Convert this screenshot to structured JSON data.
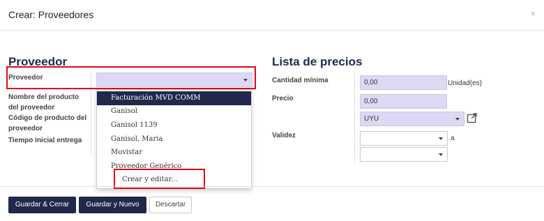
{
  "dialog": {
    "title": "Crear: Proveedores",
    "close_glyph": "×"
  },
  "proveedor_section": {
    "title": "Proveedor",
    "fields": {
      "proveedor_label": "Proveedor",
      "nombre_label": "Nombre del producto del proveedor",
      "codigo_label": "Código de producto del proveedor",
      "tiempo_label": "Tiempo inicial entrega"
    }
  },
  "dropdown": {
    "items": [
      "Facturación MVD COMM",
      "Ganisol",
      "Ganisol 1139",
      "Ganisol, Maria",
      "Movistar",
      "Proveedor Genérico"
    ],
    "create_edit_label": "Crear y editar..."
  },
  "precios_section": {
    "title": "Lista de precios",
    "cantidad_label": "Cantidad mínima",
    "cantidad_value": "0,00",
    "unidad_suffix": "Unidad(es)",
    "precio_label": "Precio",
    "precio_value": "0,00",
    "currency_value": "UYU",
    "validez_label": "Validez",
    "validez_sep": "a"
  },
  "footer": {
    "save_close_label": "Guardar & Cerrar",
    "save_new_label": "Guardar y Nuevo",
    "discard_label": "Descartar"
  },
  "colors": {
    "primary": "#20294b",
    "highlight": "#e30613",
    "field_fill": "#dcd9f4"
  }
}
